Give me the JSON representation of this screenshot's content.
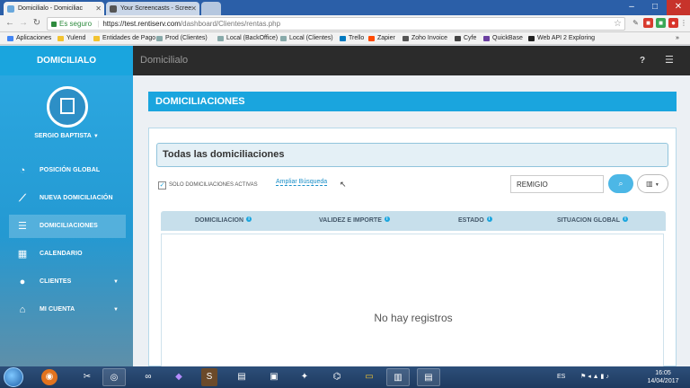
{
  "browser": {
    "tabs": [
      {
        "label": "Domicilialo - Domiciliac"
      },
      {
        "label": "Your Screencasts - Scree"
      },
      {
        "label": ""
      }
    ],
    "omnibox": {
      "secure_label": "Es seguro",
      "host": "https://test.rentiserv.com",
      "path": "/dashboard/Clientes/rentas.php"
    },
    "bookmarks": [
      "Aplicaciones",
      "Yulend",
      "Entidades de Pago",
      "Prod (Clientes)",
      "Local (BackOffice)",
      "Local (Clientes)",
      "Trello",
      "Zapier",
      "Zoho Invoice",
      "Cyfe",
      "QuickBase",
      "Web API 2 Exploring"
    ],
    "more_bookmarks": "»"
  },
  "app": {
    "brand": "DOMICILIALO",
    "breadcrumb": "Domicilialo",
    "help_icon_label": "?"
  },
  "sidebar": {
    "user_name": "SERGIO BAPTISTA",
    "items": [
      {
        "label": "POSICIÓN GLOBAL",
        "icon": "pie-chart-icon"
      },
      {
        "label": "NUEVA DOMICILIACIÓN",
        "icon": "line-chart-icon"
      },
      {
        "label": "DOMICILIACIONES",
        "icon": "list-icon"
      },
      {
        "label": "CALENDARIO",
        "icon": "calendar-icon"
      },
      {
        "label": "CLIENTES",
        "icon": "users-icon"
      },
      {
        "label": "MI CUENTA",
        "icon": "bank-icon"
      }
    ]
  },
  "main": {
    "page_title": "DOMICILIACIONES",
    "panel_title": "Todas las domiciliaciones",
    "filter_checkbox_label": "SOLO DOMICILIACIONES ACTIVAS",
    "filter_checked": true,
    "advanced_search_label": "Ampliar Búsqueda",
    "search_value": "REMIGIO",
    "table": {
      "columns": [
        "DOMICILIACION",
        "VALIDEZ E IMPORTE",
        "ESTADO",
        "SITUACION GLOBAL"
      ],
      "empty_message": "No hay registros"
    }
  },
  "taskbar": {
    "language": "ES",
    "time": "16:05",
    "date": "14/04/2017"
  },
  "colors": {
    "accent": "#1aa5de",
    "header_dark": "#2b2b2b",
    "panel_border": "#b7d9ea"
  }
}
